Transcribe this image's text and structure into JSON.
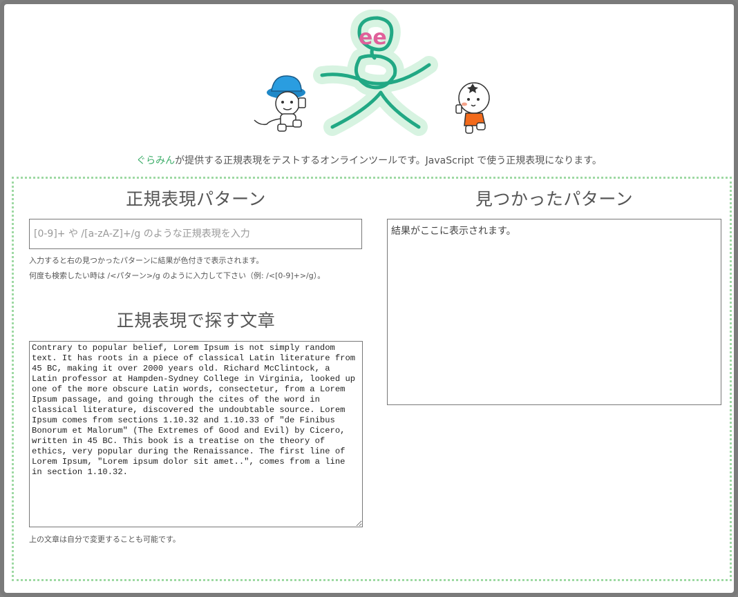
{
  "intro": {
    "brand_link": "ぐらみん",
    "text": "が提供する正規表現をテストするオンラインツールです。JavaScript で使う正規表現になります。"
  },
  "logo": {
    "letters": "ee",
    "accent_color": "#e0609a",
    "stroke_color": "#21a884",
    "glow_color": "#d7f3e1"
  },
  "pattern_section": {
    "title": "正規表現パターン",
    "input_value": "",
    "input_placeholder": "[0-9]+ や /[a-zA-Z]+/g のような正規表現を入力",
    "hint_1": "入力すると右の見つかったパターンに結果が色付きで表示されます。",
    "hint_2": "何度も検索したい時は /<パターン>/g のように入力して下さい（例: /<[0-9]+>/g）。"
  },
  "text_section": {
    "title": "正規表現で探す文章",
    "body": "Contrary to popular belief, Lorem Ipsum is not simply random text. It has roots in a piece of classical Latin literature from 45 BC, making it over 2000 years old. Richard McClintock, a Latin professor at Hampden-Sydney College in Virginia, looked up one of the more obscure Latin words, consectetur, from a Lorem Ipsum passage, and going through the cites of the word in classical literature, discovered the undoubtable source. Lorem Ipsum comes from sections 1.10.32 and 1.10.33 of \"de Finibus Bonorum et Malorum\" (The Extremes of Good and Evil) by Cicero, written in 45 BC. This book is a treatise on the theory of ethics, very popular during the Renaissance. The first line of Lorem Ipsum, \"Lorem ipsum dolor sit amet..\", comes from a line in section 1.10.32.",
    "hint": "上の文章は自分で変更することも可能です。"
  },
  "results_section": {
    "title": "見つかったパターン",
    "placeholder_text": "結果がここに表示されます。"
  }
}
